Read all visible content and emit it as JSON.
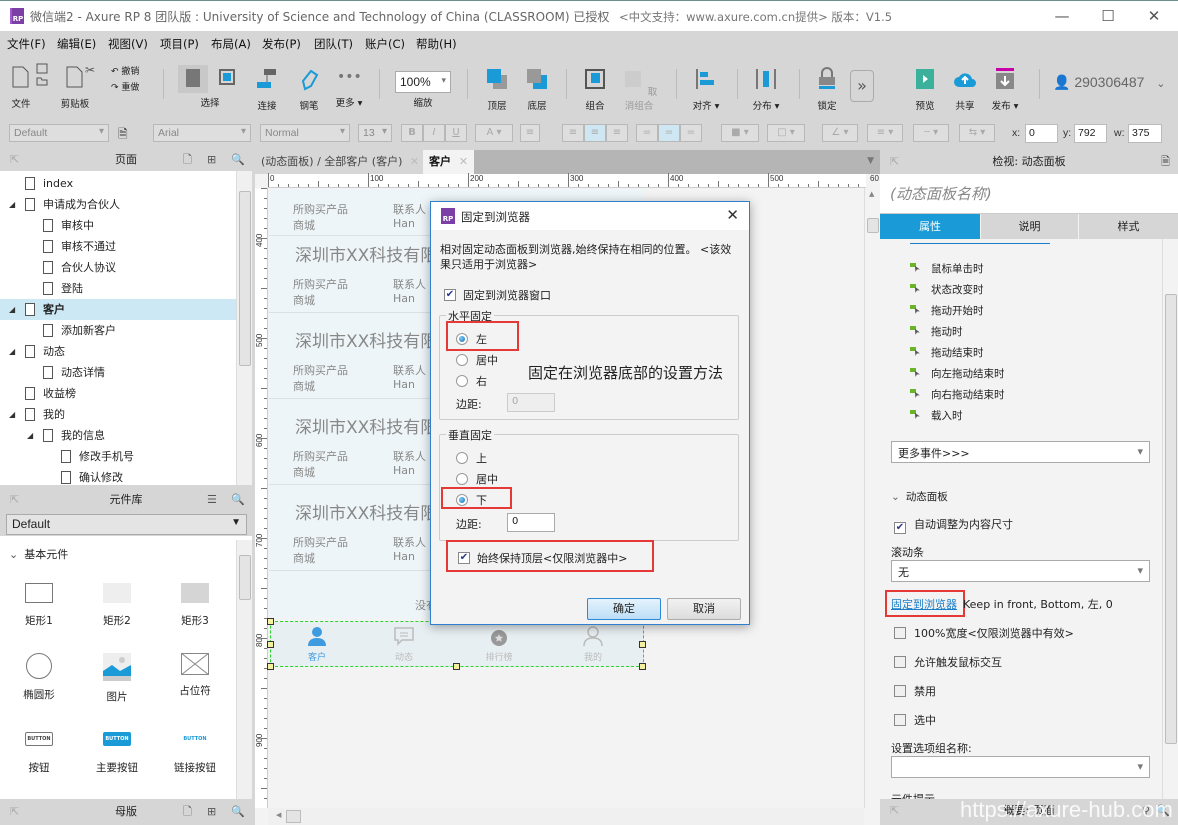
{
  "window": {
    "title": "微信端2 - Axure RP 8 团队版 : University of Science and Technology of China (CLASSROOM) 已授权",
    "support": "<中文支持：www.axure.com.cn提供> 版本：V1.5",
    "logo": "RP",
    "minimize": "—",
    "maximize": "☐",
    "close": "✕"
  },
  "menu": [
    "文件(F)",
    "编辑(E)",
    "视图(V)",
    "项目(P)",
    "布局(A)",
    "发布(P)",
    "团队(T)",
    "账户(C)",
    "帮助(H)"
  ],
  "toolbar": {
    "file": "文件",
    "clipboard": "剪贴板",
    "undo": "撤销",
    "redo": "重做",
    "select": "选择",
    "connect": "连接",
    "pen": "钢笔",
    "more": "更多 ▾",
    "zoom_value": "100%",
    "zoom_label": "缩放",
    "top": "顶层",
    "bottom": "底层",
    "group": "组合",
    "ungroup": "取消组合",
    "align": "对齐 ▾",
    "distribute": "分布 ▾",
    "lock": "锁定",
    "expand": "»",
    "preview": "预览",
    "share": "共享",
    "publish": "发布 ▾",
    "user": "290306487"
  },
  "format": {
    "style": "Default",
    "font": "Arial",
    "weight": "Normal",
    "size": "13",
    "bold": "B",
    "italic": "I",
    "underline": "U",
    "x_label": "x:",
    "x": "0",
    "y_label": "y:",
    "y": "792",
    "w_label": "w:",
    "w": "375"
  },
  "pages_panel": {
    "title": "页面",
    "items": [
      {
        "label": "index",
        "level": 1,
        "expandable": false
      },
      {
        "label": "申请成为合伙人",
        "level": 1,
        "expandable": true
      },
      {
        "label": "审核中",
        "level": 2,
        "expandable": false
      },
      {
        "label": "审核不通过",
        "level": 2,
        "expandable": false
      },
      {
        "label": "合伙人协议",
        "level": 2,
        "expandable": false
      },
      {
        "label": "登陆",
        "level": 2,
        "expandable": false
      },
      {
        "label": "客户",
        "level": 1,
        "expandable": true,
        "selected": true
      },
      {
        "label": "添加新客户",
        "level": 2,
        "expandable": false
      },
      {
        "label": "动态",
        "level": 1,
        "expandable": true
      },
      {
        "label": "动态详情",
        "level": 2,
        "expandable": false
      },
      {
        "label": "收益榜",
        "level": 1,
        "expandable": false
      },
      {
        "label": "我的",
        "level": 1,
        "expandable": true
      },
      {
        "label": "我的信息",
        "level": 2,
        "expandable": true
      },
      {
        "label": "修改手机号",
        "level": 3,
        "expandable": false
      },
      {
        "label": "确认修改",
        "level": 3,
        "expandable": false
      }
    ]
  },
  "library_panel": {
    "title": "元件库",
    "selected_library": "Default",
    "section": "基本元件",
    "items": [
      "矩形1",
      "矩形2",
      "矩形3",
      "椭圆形",
      "图片",
      "占位符",
      "按钮",
      "主要按钮",
      "链接按钮"
    ],
    "button_text": "BUTTON"
  },
  "masters_panel": {
    "title": "母版"
  },
  "editor_tabs": [
    {
      "label": "(动态面板) / 全部客户 (客户)",
      "active": false
    },
    {
      "label": "客户",
      "active": true
    }
  ],
  "ruler": {
    "h": [
      "0",
      "100",
      "200",
      "300",
      "400",
      "500",
      "60"
    ],
    "v": [
      "400",
      "500",
      "600",
      "700",
      "800",
      "900"
    ]
  },
  "mockup": {
    "cards": [
      {
        "company": "",
        "product_label": "所购买产品",
        "product": "商城",
        "contact_label": "联系人",
        "contact": "Han"
      },
      {
        "company": "深圳市XX科技有限",
        "product_label": "所购买产品",
        "product": "商城",
        "contact_label": "联系人",
        "contact": "Han"
      },
      {
        "company": "深圳市XX科技有限",
        "product_label": "所购买产品",
        "product": "商城",
        "contact_label": "联系人",
        "contact": "Han"
      },
      {
        "company": "深圳市XX科技有限",
        "product_label": "所购买产品",
        "product": "商城",
        "contact_label": "联系人",
        "contact": "Han"
      },
      {
        "company": "深圳市XX科技有限",
        "product_label": "所购买产品",
        "product": "商城",
        "contact_label": "联系人",
        "contact": "Han"
      }
    ],
    "no_more": "没有",
    "tabbar": [
      {
        "label": "客户",
        "active": true
      },
      {
        "label": "动态",
        "active": false
      },
      {
        "label": "排行榜",
        "active": false
      },
      {
        "label": "我的",
        "active": false
      }
    ]
  },
  "dialog": {
    "title": "固定到浏览器",
    "description": "相对固定动态面板到浏览器,始终保持在相同的位置。 <该效果只适用于浏览器>",
    "pin_checkbox": "固定到浏览器窗口",
    "pin_checked": true,
    "horizontal": {
      "label": "水平固定",
      "options": [
        "左",
        "居中",
        "右"
      ],
      "selected": "左",
      "margin_label": "边距:",
      "margin": "0"
    },
    "vertical": {
      "label": "垂直固定",
      "options": [
        "上",
        "居中",
        "下"
      ],
      "selected": "下",
      "margin_label": "边距:",
      "margin": "0"
    },
    "keep_front": "始终保持顶层<仅限浏览器中>",
    "keep_front_checked": true,
    "ok": "确定",
    "cancel": "取消",
    "annotation": "固定在浏览器底部的设置方法",
    "annotation_color": "#e53935"
  },
  "inspector": {
    "title": "检视: 动态面板",
    "name_placeholder": "(动态面板名称)",
    "tabs": [
      "属性",
      "说明",
      "样式"
    ],
    "active_tab": "属性",
    "events": [
      "鼠标单击时",
      "状态改变时",
      "拖动开始时",
      "拖动时",
      "拖动结束时",
      "向左拖动结束时",
      "向右拖动结束时",
      "载入时"
    ],
    "more_events": "更多事件>>>",
    "section": "动态面板",
    "auto_fit": "自动调整为内容尺寸",
    "auto_fit_checked": true,
    "scrollbar_label": "滚动条",
    "scrollbar_value": "无",
    "pin_link": "固定到浏览器",
    "pin_summary": "Keep in front, Bottom, 左, 0",
    "full_width": "100%宽度<仅限浏览器中有效>",
    "allow_mouse": "允许触发鼠标交互",
    "disabled": "禁用",
    "selected": "选中",
    "group_name_label": "设置选项组名称:",
    "group_name_value": "",
    "tooltip_label": "元件提示",
    "bottom_panel": "概要: 页面"
  },
  "watermark": "https://axure-hub.com",
  "colors": {
    "accent": "#1a9bd7",
    "selection": "#cce8f4",
    "annotation": "#e53935"
  }
}
